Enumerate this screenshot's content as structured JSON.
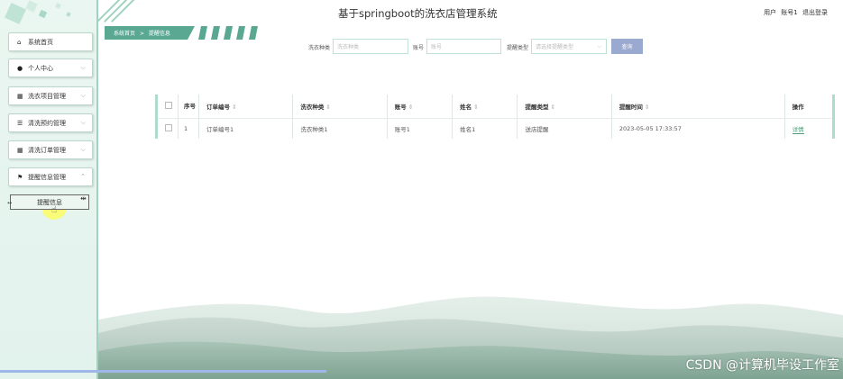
{
  "header": {
    "title": "基于springboot的洗衣店管理系统",
    "user_label": "用户",
    "username": "账号1",
    "logout_label": "退出登录"
  },
  "breadcrumb": {
    "home": "系统首页",
    "separator": ">",
    "current": "提醒信息"
  },
  "sidebar": {
    "items": [
      {
        "label": "系统首页",
        "icon": "home-icon"
      },
      {
        "label": "个人中心",
        "icon": "user-icon"
      },
      {
        "label": "洗衣项目管理",
        "icon": "grid-icon"
      },
      {
        "label": "清洗预约管理",
        "icon": "list-icon"
      },
      {
        "label": "清洗订单管理",
        "icon": "grid-icon"
      },
      {
        "label": "提醒信息管理",
        "icon": "flag-icon"
      }
    ],
    "submenu_item": "提醒信息"
  },
  "search": {
    "type_label": "洗衣种类",
    "type_placeholder": "洗衣种类",
    "account_label": "账号",
    "account_placeholder": "账号",
    "remind_label": "提醒类型",
    "remind_placeholder": "请选择提醒类型",
    "button": "查询"
  },
  "table": {
    "headers": [
      "序号",
      "订单编号",
      "洗衣种类",
      "账号",
      "姓名",
      "提醒类型",
      "提醒时间",
      "操作"
    ],
    "rows": [
      {
        "index": "1",
        "order_no": "订单编号1",
        "type": "洗衣种类1",
        "account": "账号1",
        "name": "姓名1",
        "remind_type": "送店提醒",
        "time": "2023-05-05 17:33:57",
        "action": "详情"
      }
    ]
  },
  "watermark": "CSDN @计算机毕设工作室",
  "colors": {
    "accent": "#5aa892",
    "sidebar_bg": "#e7f4ef",
    "search_button": "#9aa9d0"
  }
}
